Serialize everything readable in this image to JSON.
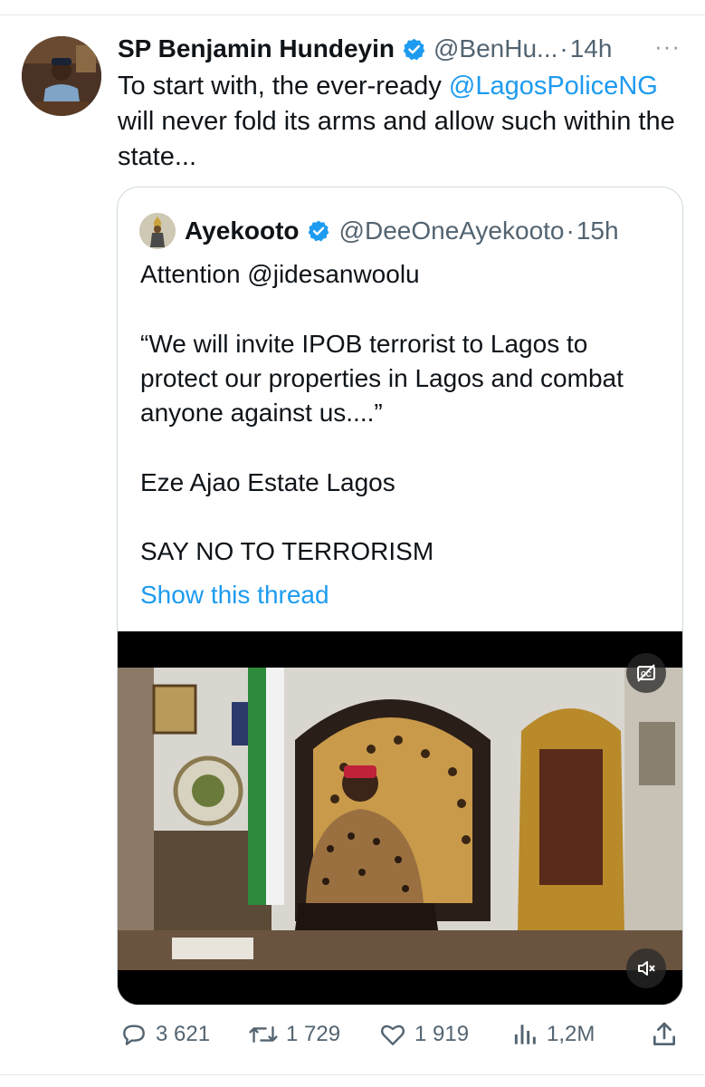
{
  "tweet": {
    "author_name": "SP Benjamin Hundeyin",
    "author_handle": "@BenHu...",
    "separator": "·",
    "time": "14h",
    "more_label": "···",
    "text_before": "To start with, the ever-ready ",
    "mention": "@LagosPoliceNG",
    "text_after": " will never fold its arms and allow such within the state..."
  },
  "quote": {
    "author_name": "Ayekooto",
    "author_handle": "@DeeOneAyekooto",
    "separator": "·",
    "time": "15h",
    "line1": "Attention @jidesanwoolu",
    "paragraph": "“We will invite IPOB terrorist to Lagos to protect our properties in Lagos and combat anyone against us....”",
    "line2": "Eze Ajao Estate Lagos",
    "line3": "SAY NO TO TERRORISM",
    "show_thread": "Show this thread"
  },
  "actions": {
    "replies": "3 621",
    "reposts": "1 729",
    "likes": "1 919",
    "views": "1,2M"
  },
  "colors": {
    "accent": "#1d9bf0",
    "secondary_text": "#536471",
    "border": "#cfd9de"
  },
  "icons": [
    "verified-badge-icon",
    "more-icon",
    "closed-captions-icon",
    "muted-speaker-icon",
    "reply-icon",
    "repost-icon",
    "like-icon",
    "views-icon",
    "share-icon"
  ]
}
